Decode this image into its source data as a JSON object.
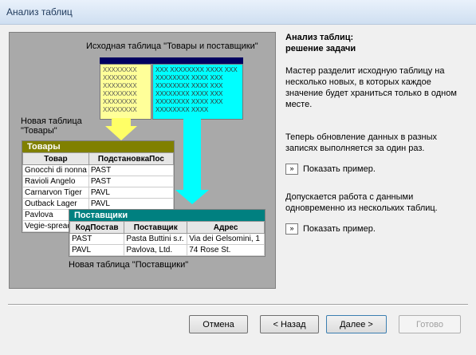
{
  "window": {
    "title": "Анализ таблиц"
  },
  "diagram": {
    "source_label": "Исходная таблица \"Товары и поставщики\"",
    "source_left_text": "XXXXXXXX XXXXXXXX XXXXXXXX XXXXXXXX XXXXXXXX XXXXXXXX",
    "source_right_text": "XXX XXXXXXXX XXXX XXX XXXXXXXX XXXX XXX XXXXXXXX XXXX XXX XXXXXXXX XXXX XXX XXXXXXXX XXXX XXX XXXXXXXX XXXX",
    "new_goods_label_1": "Новая таблица",
    "new_goods_label_2": "\"Товары\"",
    "goods_table": {
      "caption": "Товары",
      "headers": [
        "Товар",
        "ПодстановкаПос"
      ],
      "rows": [
        [
          "Gnocchi di nonna",
          "PAST"
        ],
        [
          "Ravioli Angelo",
          "PAST"
        ],
        [
          "Carnarvon Tiger",
          "PAVL"
        ],
        [
          "Outback Lager",
          "PAVL"
        ],
        [
          "Pavlova",
          ""
        ],
        [
          "Vegie-spread",
          ""
        ]
      ]
    },
    "suppliers_table": {
      "caption": "Поставщики",
      "headers": [
        "КодПостав",
        "Поставщик",
        "Адрес"
      ],
      "rows": [
        [
          "PAST",
          "Pasta Buttini s.r.",
          "Via dei Gelsomini, 1"
        ],
        [
          "PAVL",
          "Pavlova, Ltd.",
          "74 Rose St."
        ]
      ]
    },
    "new_suppliers_label": "Новая таблица \"Поставщики\""
  },
  "info": {
    "title_1": "Анализ таблиц:",
    "title_2": "решение задачи",
    "para1": "Мастер разделит исходную таблицу на несколько новых, в которых каждое значение будет храниться только в одном месте.",
    "para2": "Теперь обновление данных в разных записях выполняется за один раз.",
    "example_btn_glyph": "»",
    "example1_label": "Показать пример.",
    "para3": "Допускается работа с данными одновременно из нескольких таблиц.",
    "example2_label": "Показать пример."
  },
  "buttons": {
    "cancel": "Отмена",
    "back": "< Назад",
    "next": "Далее >",
    "finish": "Готово"
  }
}
